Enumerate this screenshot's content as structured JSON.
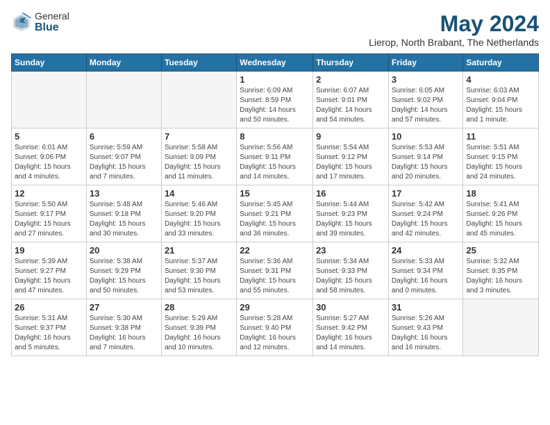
{
  "header": {
    "logo_general": "General",
    "logo_blue": "Blue",
    "month_title": "May 2024",
    "location": "Lierop, North Brabant, The Netherlands"
  },
  "weekdays": [
    "Sunday",
    "Monday",
    "Tuesday",
    "Wednesday",
    "Thursday",
    "Friday",
    "Saturday"
  ],
  "weeks": [
    [
      {
        "day": "",
        "info": ""
      },
      {
        "day": "",
        "info": ""
      },
      {
        "day": "",
        "info": ""
      },
      {
        "day": "1",
        "info": "Sunrise: 6:09 AM\nSunset: 8:59 PM\nDaylight: 14 hours\nand 50 minutes."
      },
      {
        "day": "2",
        "info": "Sunrise: 6:07 AM\nSunset: 9:01 PM\nDaylight: 14 hours\nand 54 minutes."
      },
      {
        "day": "3",
        "info": "Sunrise: 6:05 AM\nSunset: 9:02 PM\nDaylight: 14 hours\nand 57 minutes."
      },
      {
        "day": "4",
        "info": "Sunrise: 6:03 AM\nSunset: 9:04 PM\nDaylight: 15 hours\nand 1 minute."
      }
    ],
    [
      {
        "day": "5",
        "info": "Sunrise: 6:01 AM\nSunset: 9:06 PM\nDaylight: 15 hours\nand 4 minutes."
      },
      {
        "day": "6",
        "info": "Sunrise: 5:59 AM\nSunset: 9:07 PM\nDaylight: 15 hours\nand 7 minutes."
      },
      {
        "day": "7",
        "info": "Sunrise: 5:58 AM\nSunset: 9:09 PM\nDaylight: 15 hours\nand 11 minutes."
      },
      {
        "day": "8",
        "info": "Sunrise: 5:56 AM\nSunset: 9:11 PM\nDaylight: 15 hours\nand 14 minutes."
      },
      {
        "day": "9",
        "info": "Sunrise: 5:54 AM\nSunset: 9:12 PM\nDaylight: 15 hours\nand 17 minutes."
      },
      {
        "day": "10",
        "info": "Sunrise: 5:53 AM\nSunset: 9:14 PM\nDaylight: 15 hours\nand 20 minutes."
      },
      {
        "day": "11",
        "info": "Sunrise: 5:51 AM\nSunset: 9:15 PM\nDaylight: 15 hours\nand 24 minutes."
      }
    ],
    [
      {
        "day": "12",
        "info": "Sunrise: 5:50 AM\nSunset: 9:17 PM\nDaylight: 15 hours\nand 27 minutes."
      },
      {
        "day": "13",
        "info": "Sunrise: 5:48 AM\nSunset: 9:18 PM\nDaylight: 15 hours\nand 30 minutes."
      },
      {
        "day": "14",
        "info": "Sunrise: 5:46 AM\nSunset: 9:20 PM\nDaylight: 15 hours\nand 33 minutes."
      },
      {
        "day": "15",
        "info": "Sunrise: 5:45 AM\nSunset: 9:21 PM\nDaylight: 15 hours\nand 36 minutes."
      },
      {
        "day": "16",
        "info": "Sunrise: 5:44 AM\nSunset: 9:23 PM\nDaylight: 15 hours\nand 39 minutes."
      },
      {
        "day": "17",
        "info": "Sunrise: 5:42 AM\nSunset: 9:24 PM\nDaylight: 15 hours\nand 42 minutes."
      },
      {
        "day": "18",
        "info": "Sunrise: 5:41 AM\nSunset: 9:26 PM\nDaylight: 15 hours\nand 45 minutes."
      }
    ],
    [
      {
        "day": "19",
        "info": "Sunrise: 5:39 AM\nSunset: 9:27 PM\nDaylight: 15 hours\nand 47 minutes."
      },
      {
        "day": "20",
        "info": "Sunrise: 5:38 AM\nSunset: 9:29 PM\nDaylight: 15 hours\nand 50 minutes."
      },
      {
        "day": "21",
        "info": "Sunrise: 5:37 AM\nSunset: 9:30 PM\nDaylight: 15 hours\nand 53 minutes."
      },
      {
        "day": "22",
        "info": "Sunrise: 5:36 AM\nSunset: 9:31 PM\nDaylight: 15 hours\nand 55 minutes."
      },
      {
        "day": "23",
        "info": "Sunrise: 5:34 AM\nSunset: 9:33 PM\nDaylight: 15 hours\nand 58 minutes."
      },
      {
        "day": "24",
        "info": "Sunrise: 5:33 AM\nSunset: 9:34 PM\nDaylight: 16 hours\nand 0 minutes."
      },
      {
        "day": "25",
        "info": "Sunrise: 5:32 AM\nSunset: 9:35 PM\nDaylight: 16 hours\nand 3 minutes."
      }
    ],
    [
      {
        "day": "26",
        "info": "Sunrise: 5:31 AM\nSunset: 9:37 PM\nDaylight: 16 hours\nand 5 minutes."
      },
      {
        "day": "27",
        "info": "Sunrise: 5:30 AM\nSunset: 9:38 PM\nDaylight: 16 hours\nand 7 minutes."
      },
      {
        "day": "28",
        "info": "Sunrise: 5:29 AM\nSunset: 9:39 PM\nDaylight: 16 hours\nand 10 minutes."
      },
      {
        "day": "29",
        "info": "Sunrise: 5:28 AM\nSunset: 9:40 PM\nDaylight: 16 hours\nand 12 minutes."
      },
      {
        "day": "30",
        "info": "Sunrise: 5:27 AM\nSunset: 9:42 PM\nDaylight: 16 hours\nand 14 minutes."
      },
      {
        "day": "31",
        "info": "Sunrise: 5:26 AM\nSunset: 9:43 PM\nDaylight: 16 hours\nand 16 minutes."
      },
      {
        "day": "",
        "info": ""
      }
    ]
  ]
}
